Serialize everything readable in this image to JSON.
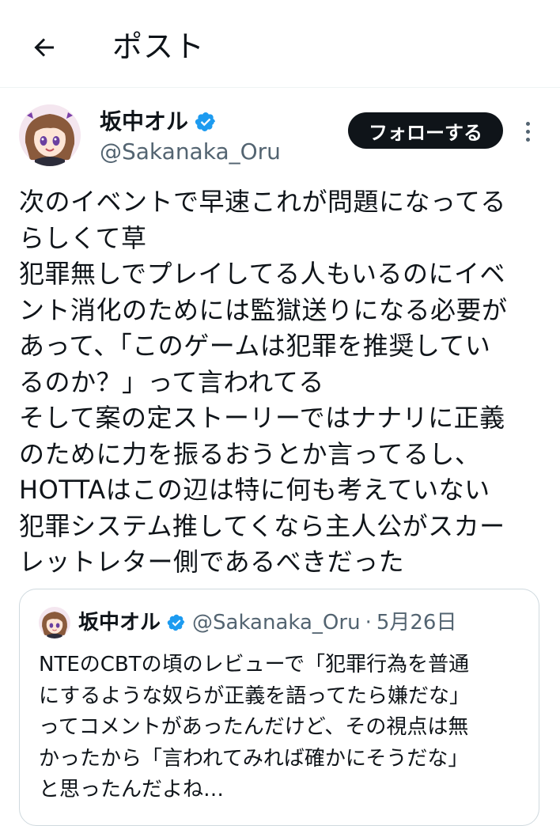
{
  "header": {
    "title": "ポスト",
    "back_icon": "arrow-left-icon"
  },
  "author": {
    "name": "坂中オル",
    "handle": "@Sakanaka_Oru",
    "verified_icon": "verified-badge-icon",
    "follow_label": "フォローする",
    "more_icon": "more-vertical-icon"
  },
  "post": {
    "lines": [
      "次のイベントで早速これが問題になってる",
      "らしくて草",
      "犯罪無しでプレイしてる人もいるのにイベ",
      "ント消化のためには監獄送りになる必要が",
      "あって、「このゲームは犯罪を推奨してい",
      "るのか？」って言われてる",
      "そして案の定ストーリーではナナリに正義",
      "のために力を振るおうとか言ってるし、",
      "HOTTAはこの辺は特に何も考えていない",
      "犯罪システム推してくなら主人公がスカー",
      "レットレター側であるべきだった"
    ]
  },
  "quote": {
    "name": "坂中オル",
    "handle": "@Sakanaka_Oru",
    "separator": "·",
    "date": "5月26日",
    "lines": [
      "NTEのCBTの頃のレビューで「犯罪行為を普通",
      "にするような奴らが正義を語ってたら嫌だな」",
      "ってコメントがあったんだけど、その視点は無",
      "かったから「言われてみれば確かにそうだな」",
      "と思ったんだよね…"
    ]
  },
  "colors": {
    "text": "#0f1419",
    "secondary": "#536471",
    "verified": "#1d9bf0",
    "button_bg": "#0f1419",
    "border": "#cfd9de"
  }
}
